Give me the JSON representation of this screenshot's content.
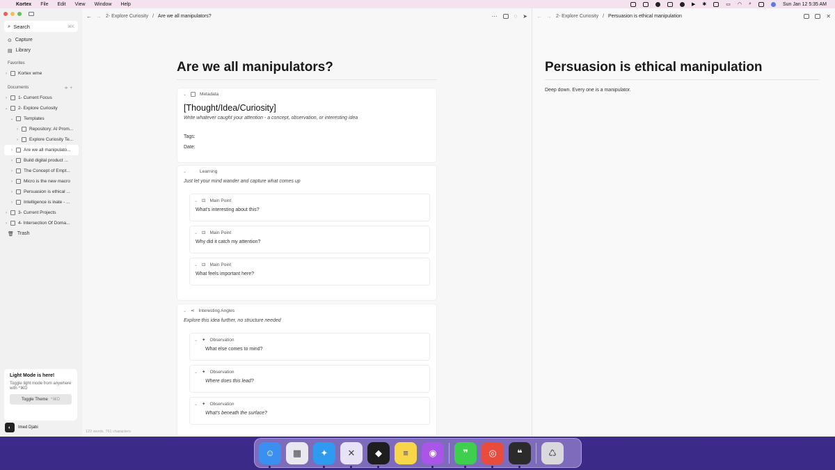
{
  "menubar": {
    "app_name": "Kortex",
    "menus": [
      "File",
      "Edit",
      "View",
      "Window",
      "Help"
    ],
    "clock": "Sun Jan 12  5:35 AM"
  },
  "sidebar": {
    "search": {
      "label": "Search",
      "shortcut": "⌘K"
    },
    "nav": [
      {
        "label": "Capture",
        "icon": "capture-icon"
      },
      {
        "label": "Library",
        "icon": "library-icon"
      }
    ],
    "favorites_label": "Favorites",
    "favorites": [
      {
        "label": "Kortex wme"
      }
    ],
    "documents_label": "Documents",
    "documents": [
      {
        "label": "1- Current Focus",
        "level": 0,
        "chev": "›"
      },
      {
        "label": "2- Explore Curiosity",
        "level": 0,
        "chev": "⌄"
      },
      {
        "label": "Templates",
        "level": 1,
        "chev": "⌄"
      },
      {
        "label": "Repository: AI Prom...",
        "level": 2,
        "chev": "›"
      },
      {
        "label": "Explore Curiosity Te...",
        "level": 2,
        "chev": "›"
      },
      {
        "label": "Are we all manipulato...",
        "level": 1,
        "chev": "›",
        "active": true
      },
      {
        "label": "Build digital product ...",
        "level": 1,
        "chev": "›"
      },
      {
        "label": "The Concept of Empt...",
        "level": 1,
        "chev": "›"
      },
      {
        "label": "Micro is the new macro",
        "level": 1,
        "chev": "›"
      },
      {
        "label": "Persuasion is ethical ...",
        "level": 1,
        "chev": "›"
      },
      {
        "label": "Intelligence is inate - ...",
        "level": 1,
        "chev": "›"
      },
      {
        "label": "3- Current Projects",
        "level": 0,
        "chev": "›"
      },
      {
        "label": "4- Intersection Of Doma...",
        "level": 0,
        "chev": "›"
      }
    ],
    "trash_label": "Trash",
    "promo": {
      "title": "Light Mode is here!",
      "text": "Toggle light mode from anywhere with  ^⌘D",
      "button": "Toggle Theme",
      "button_shortcut": "^⌘D"
    },
    "user_name": "Imed Djabi"
  },
  "left_pane": {
    "breadcrumb_parent": "2- Explore Curiosity",
    "breadcrumb_sep": "/",
    "breadcrumb_current": "Are we all manipulators?",
    "title": "Are we all manipulators?",
    "metadata": {
      "label": "Metadata",
      "heading": "[Thought/Idea/Curiosity]",
      "prompt": "Write whatever caught your attention - a concept, observation, or interesting idea",
      "tags_label": "Tags:",
      "date_label": "Date:"
    },
    "learning": {
      "label": "Learning",
      "prompt": "Just let your mind wander and capture what comes up",
      "points": [
        {
          "label": "Main Point",
          "text": "What's interesting about this?"
        },
        {
          "label": "Main Point",
          "text": "Why did it catch my attention?"
        },
        {
          "label": "Main Point",
          "text": "What feels important here?"
        }
      ]
    },
    "angles": {
      "label": "Interesting Angles",
      "prompt": "Explore this idea further, no structure needed",
      "observations": [
        {
          "label": "Observation",
          "text": "What else comes to mind?"
        },
        {
          "label": "Observation",
          "text": "Where does this lead?"
        },
        {
          "label": "Observation",
          "text": "What's beneath the surface?"
        }
      ]
    },
    "word_count": "122 words, 761 characters"
  },
  "right_pane": {
    "breadcrumb_parent": "2- Explore Curiosity",
    "breadcrumb_sep": "/",
    "breadcrumb_current": "Persuasion is ethical manipulation",
    "title": "Persuasion is ethical manipulation",
    "body": "Deep down. Every one is a manipulator."
  },
  "dock": {
    "apps": [
      {
        "name": "Finder",
        "color": "#3b8ff0",
        "glyph": "☺"
      },
      {
        "name": "Launchpad",
        "color": "#e8e8ee",
        "glyph": "▦"
      },
      {
        "name": "Safari",
        "color": "#2f9bf0",
        "glyph": "✦"
      },
      {
        "name": "Kortex",
        "color": "#e7e2f5",
        "glyph": "✕"
      },
      {
        "name": "Figma",
        "color": "#1e1e1e",
        "glyph": "◆"
      },
      {
        "name": "Notes",
        "color": "#f8d64a",
        "glyph": "≡"
      },
      {
        "name": "Podcasts",
        "color": "#a855e8",
        "glyph": "◉"
      },
      {
        "name": "Messages",
        "color": "#3fcf4e",
        "glyph": "❞"
      },
      {
        "name": "Chrome",
        "color": "#e94b3c",
        "glyph": "◎"
      },
      {
        "name": "ChatGPT",
        "color": "#2b2b2b",
        "glyph": "❝"
      },
      {
        "name": "Trash",
        "color": "#d9d9dd",
        "glyph": "♺"
      }
    ]
  }
}
